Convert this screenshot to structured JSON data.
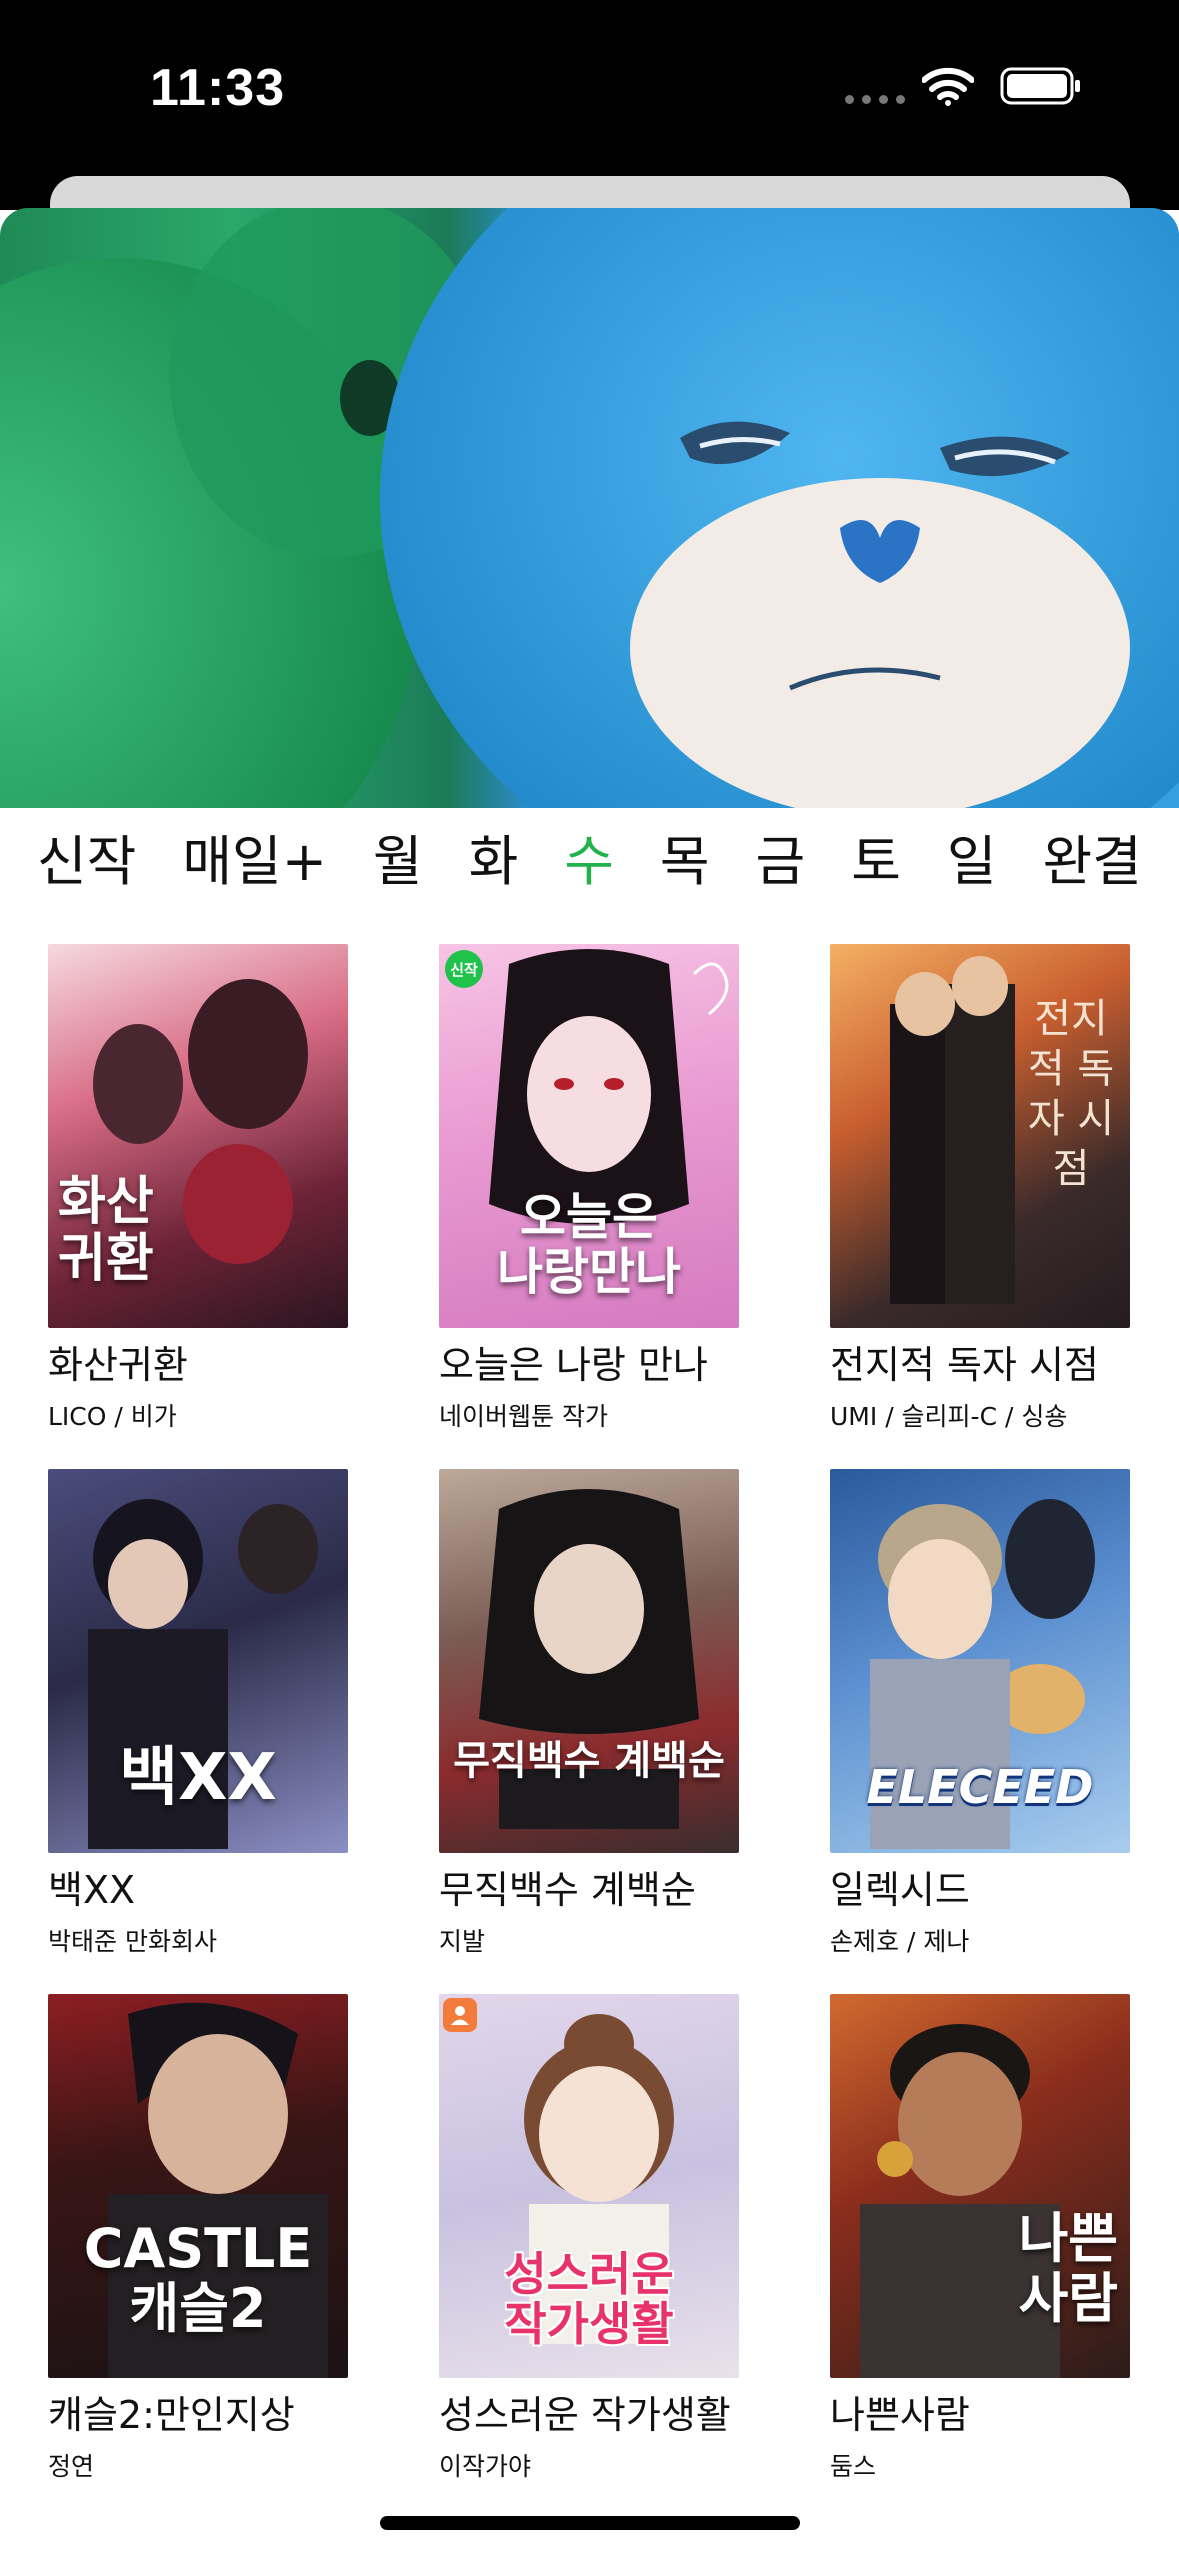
{
  "status_bar": {
    "time": "11:33"
  },
  "tabs": [
    {
      "label": "신작",
      "active": false
    },
    {
      "label": "매일+",
      "active": false
    },
    {
      "label": "월",
      "active": false
    },
    {
      "label": "화",
      "active": false
    },
    {
      "label": "수",
      "active": true
    },
    {
      "label": "목",
      "active": false
    },
    {
      "label": "금",
      "active": false
    },
    {
      "label": "토",
      "active": false
    },
    {
      "label": "일",
      "active": false
    },
    {
      "label": "완결",
      "active": false
    }
  ],
  "comics": [
    {
      "title": "화산귀환",
      "author": "LICO / 비가",
      "cover_text": "화산\n귀환"
    },
    {
      "title": "오늘은 나랑 만나",
      "author": "네이버웹툰 작가",
      "cover_text": "오늘은\n나랑만나",
      "badge": "신작"
    },
    {
      "title": "전지적 독자 시점",
      "author": "UMI / 슬리피-C / 싱숑",
      "cover_text": "전지적 독자 시점"
    },
    {
      "title": "백XX",
      "author": "박태준 만화회사",
      "cover_text": "백XX"
    },
    {
      "title": "무직백수 계백순",
      "author": "지발",
      "cover_text": "무직백수 계백순"
    },
    {
      "title": "일렉시드",
      "author": "손제호 / 제나",
      "cover_text": "ELECEED"
    },
    {
      "title": "캐슬2:만인지상",
      "author": "정연",
      "cover_text": "CASTLE\n캐슬2"
    },
    {
      "title": "성스러운 작가생활",
      "author": "이작가야",
      "cover_text": "성스러운\n작가생활"
    },
    {
      "title": "나쁜사람",
      "author": "둠스",
      "cover_text": "나쁜\n사람"
    }
  ],
  "colors": {
    "active_tab": "#21b24b",
    "new_badge": "#1fc34b"
  }
}
